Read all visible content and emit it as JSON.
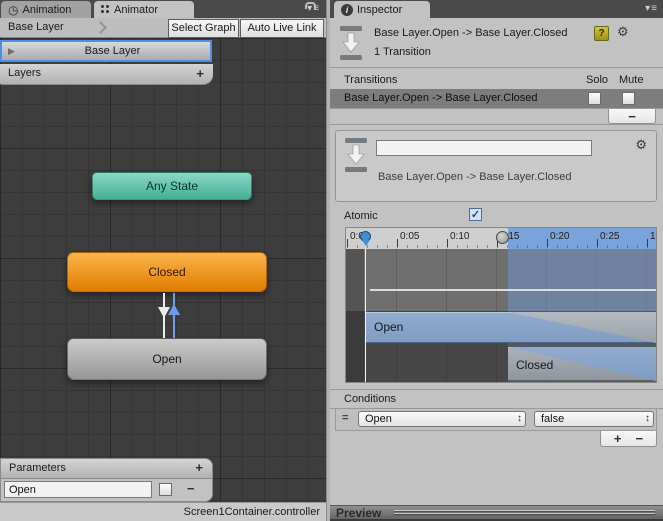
{
  "colors": {
    "selection_blue": "#4E8EE8",
    "node_teal": "#43B096",
    "node_orange": "#E17D00",
    "node_gray": "#989898",
    "transition_bar_blue": "#7E9CC4",
    "arrow_blue": "#6F9BE8",
    "ruler_highlight_blue": "#7AA2DB"
  },
  "icons": {
    "clock": "◷",
    "info": "i",
    "menu": "▾≡",
    "gear": "⚙",
    "help": "?",
    "check": "✓",
    "expander": "▶",
    "updown": "↕",
    "plus": "+",
    "minus": "−",
    "handle": "="
  },
  "left_panel": {
    "tabs": [
      {
        "label": "Animation"
      },
      {
        "label": "Animator"
      }
    ],
    "toolbar": {
      "breadcrumb": "Base Layer",
      "select_graph": "Select Graph",
      "auto_live_link": "Auto Live Link"
    },
    "layer_row": {
      "label": "Base Layer"
    },
    "layers_bar": {
      "label": "Layers"
    },
    "graph": {
      "nodes": {
        "any_state": "Any State",
        "closed": "Closed",
        "open": "Open"
      }
    },
    "parameters": {
      "header": "Parameters",
      "rows": [
        {
          "value": "Open"
        }
      ]
    },
    "status_bar": "Screen1Container.controller"
  },
  "inspector": {
    "tab": "Inspector",
    "header": {
      "title": "Base Layer.Open -> Base Layer.Closed",
      "subtitle": "1 Transition"
    },
    "transitions": {
      "title": "Transitions",
      "solo": "Solo",
      "mute": "Mute",
      "rows": [
        {
          "label": "Base Layer.Open -> Base Layer.Closed"
        }
      ]
    },
    "detail": {
      "name_value": "",
      "label": "Base Layer.Open -> Base Layer.Closed"
    },
    "atomic": {
      "label": "Atomic",
      "checked": true
    },
    "timeline": {
      "ticks": [
        "0:00",
        "0:05",
        "0:10",
        "0:15",
        "0:20",
        "0:25",
        "1"
      ],
      "tracks": [
        {
          "label": "Open"
        },
        {
          "label": "Closed"
        }
      ]
    },
    "conditions": {
      "title": "Conditions",
      "rows": [
        {
          "parameter": "Open",
          "value": "false"
        }
      ]
    },
    "preview": {
      "label": "Preview"
    }
  }
}
